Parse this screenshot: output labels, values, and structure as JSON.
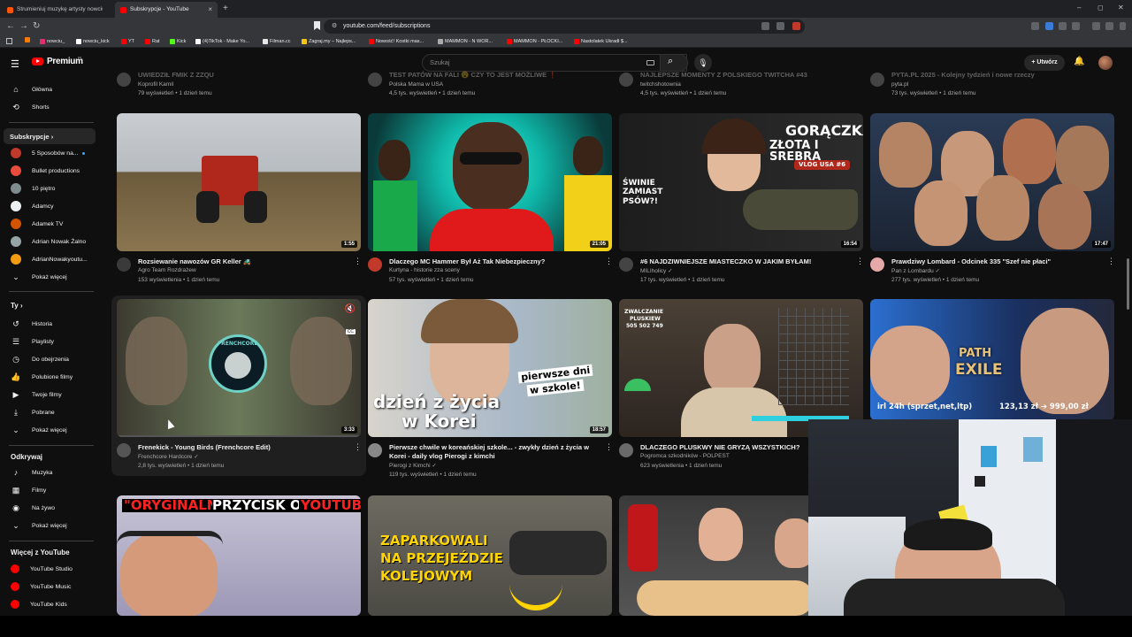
{
  "browser": {
    "tabs": [
      {
        "label": "Strumieniuj muzykę artysty nowciu |"
      },
      {
        "label": "Subskrypcje - YouTube",
        "close": "×"
      }
    ],
    "new_tab": "+",
    "url": "youtube.com/feed/subscriptions",
    "window_controls": {
      "minimize": "–",
      "maximize": "◻",
      "close": "✕"
    },
    "nav": {
      "back": "←",
      "forward": "→",
      "reload": "↻"
    },
    "bookmarks": [
      {
        "label": "",
        "color": "#ff7a00"
      },
      {
        "label": "nowciu_",
        "color": "#e1306c"
      },
      {
        "label": "nowciu_kick",
        "color": "#ffffff"
      },
      {
        "label": "YT",
        "color": "#ff0000"
      },
      {
        "label": "Rat",
        "color": "#ff0000"
      },
      {
        "label": "Kick",
        "color": "#53fc18"
      },
      {
        "label": "(4)TikTok - Make Yo...",
        "color": "#ffffff"
      },
      {
        "label": "Filman.cc",
        "color": "#e8e8e8"
      },
      {
        "label": "Zagraj.my – Najleps...",
        "color": "#f5c518"
      },
      {
        "label": "Nowość! Kostki mas...",
        "color": "#ff0000"
      },
      {
        "label": "MAMMON - N WOR...",
        "color": "#aaaaaa"
      },
      {
        "label": "MAMMON - PŁOCKI...",
        "color": "#ff0000"
      },
      {
        "label": "Nastolatek Ukradł $...",
        "color": "#ff0000"
      }
    ]
  },
  "header": {
    "logo_text": "Premium",
    "logo_sup": "PL",
    "search_placeholder": "Szukaj",
    "create_label": "+ Utwórz"
  },
  "sidebar": {
    "main": [
      {
        "label": "Główna",
        "icon": "⌂"
      },
      {
        "label": "Shorts",
        "icon": "⟲"
      }
    ],
    "subs_heading": "Subskrypcje  ›",
    "subs": [
      {
        "label": "5 Sposobów na...",
        "color": "#c0392b",
        "dot": true
      },
      {
        "label": "Bullet productions",
        "color": "#e74c3c"
      },
      {
        "label": "10 piętro",
        "color": "#7f8c8d"
      },
      {
        "label": "Adamcy",
        "color": "#ecf0f1"
      },
      {
        "label": "Adamek TV",
        "color": "#d35400"
      },
      {
        "label": "Adrian Nowak Żalno",
        "color": "#95a5a6"
      },
      {
        "label": "AdrianNowakyoutu...",
        "color": "#f39c12"
      }
    ],
    "subs_more": "Pokaż więcej",
    "you_heading": "Ty  ›",
    "you": [
      {
        "label": "Historia",
        "icon": "↺"
      },
      {
        "label": "Playlisty",
        "icon": "☰"
      },
      {
        "label": "Do obejrzenia",
        "icon": "◷"
      },
      {
        "label": "Polubione filmy",
        "icon": "👍"
      },
      {
        "label": "Twoje filmy",
        "icon": "▶"
      },
      {
        "label": "Pobrane",
        "icon": "⤓"
      }
    ],
    "you_more": "Pokaż więcej",
    "explore_heading": "Odkrywaj",
    "explore": [
      {
        "label": "Muzyka",
        "icon": "♪"
      },
      {
        "label": "Filmy",
        "icon": "▦"
      },
      {
        "label": "Na żywo",
        "icon": "◉"
      }
    ],
    "explore_more": "Pokaż więcej",
    "more_heading": "Więcej z YouTube",
    "more": [
      {
        "label": "YouTube Studio"
      },
      {
        "label": "YouTube Music"
      },
      {
        "label": "YouTube Kids"
      }
    ]
  },
  "top_row_partial": [
    {
      "title": "UWIEDZIŁ FMIK Z ZZQU",
      "channel": "Koprofil Kamil",
      "meta": "79 wyświetleń • 1 dzień temu"
    },
    {
      "title": "TEST PATÓW NA FALI 😮 CZY TO JEST MOŻLIWE ❗",
      "channel": "Polska Mama w USA",
      "meta": "4,5 tys. wyświetleń • 1 dzień temu"
    },
    {
      "title": "NAJLEPSZE MOMENTY Z POLSKIEGO TWITCHA #43",
      "channel": "twitchshotownia",
      "meta": "4,5 tys. wyświetleń • 1 dzień temu"
    },
    {
      "title": "PYTA.PL 2025 - Kolejny tydzień i nowe rzeczy",
      "channel": "pyta.pl",
      "meta": "73 tys. wyświetleń • 1 dzień temu"
    }
  ],
  "videos": [
    {
      "title": "Rozsiewanie nawozów GR Keller 🚜",
      "channel": "Agro Team Rozdrażew",
      "meta": "153 wyświetlenia • 1 dzień temu",
      "duration": "1:55"
    },
    {
      "title": "Dlaczego MC Hammer Był Aż Tak Niebezpieczny?",
      "channel": "Kurtyna - historie zza sceny",
      "meta": "57 tys. wyświetleń • 1 dzień temu",
      "duration": "21:05"
    },
    {
      "title": "#6 NAJDZIWNIEJSZE MIASTECZKO W JAKIM BYŁAM!",
      "channel": "MILIholicy ✓",
      "meta": "17 tys. wyświetleń • 1 dzień temu",
      "duration": "16:54",
      "overlay1": "GORĄCZKA",
      "overlay2": "ZŁOTA I SREBRA",
      "overlay3": "VLOG USA #6",
      "overlay4": "ŚWINIE ZAMIAST PSÓW?!"
    },
    {
      "title": "Prawdziwy Lombard - Odcinek 335 \"Szef nie płaci\"",
      "channel": "Pan z Lombardu ✓",
      "meta": "277 tys. wyświetleń • 1 dzień temu",
      "duration": "17:47"
    },
    {
      "title": "Frenekick - Young Birds (Frenchcore Edit)",
      "channel": "Frenchcore Hardcore ✓",
      "meta": "2,8 tys. wyświetleń • 1 dzień temu",
      "duration": "3:33",
      "overlay1": "FRENCHCORE"
    },
    {
      "title": "Pierwsze chwile w koreańskiej szkole... - zwykły dzień z życia w",
      "title2": "Korei - daily vlog Pierogi z kimchi",
      "channel": "Pierogi z Kimchi ✓",
      "meta": "119 tys. wyświetleń • 1 dzień temu",
      "duration": "18:57",
      "overlay1": "dzień z życia",
      "overlay2": "w Korei",
      "overlay3": "pierwsze dni",
      "overlay4": "w szkole!"
    },
    {
      "title": "DLACZEGO PLUSKWY NIE GRYZĄ WSZYSTKICH?",
      "channel": "Pogromca szkodników - POLPEST",
      "meta": "623 wyświetlenia • 1 dzień temu",
      "overlay1": "ZWALCZANIE",
      "overlay2": "PLUSKIEW",
      "overlay3": "505 502 749"
    },
    {
      "title": "",
      "channel": "",
      "meta": "",
      "overlay1": "PATH",
      "overlay2": "EXILE",
      "overlay3": "irl 24h (sprzet,net,ltp)",
      "overlay4": "123,13 zł ➔ 999,00 zł"
    }
  ],
  "bottom_row": [
    {
      "overlay1": "\"ORYGINALNY\"",
      "overlay2": "PRZYCISK OD",
      "overlay3": "YOUTUBE"
    },
    {
      "overlay1": "ZAPARKOWALI",
      "overlay2": "NA PRZEJEŹDZIE",
      "overlay3": "KOLEJOWYM"
    },
    {}
  ],
  "colors": {
    "accent": "#ff0000",
    "background": "#0f0f0f",
    "text": "#f1f1f1",
    "secondary": "#aaaaaa"
  }
}
